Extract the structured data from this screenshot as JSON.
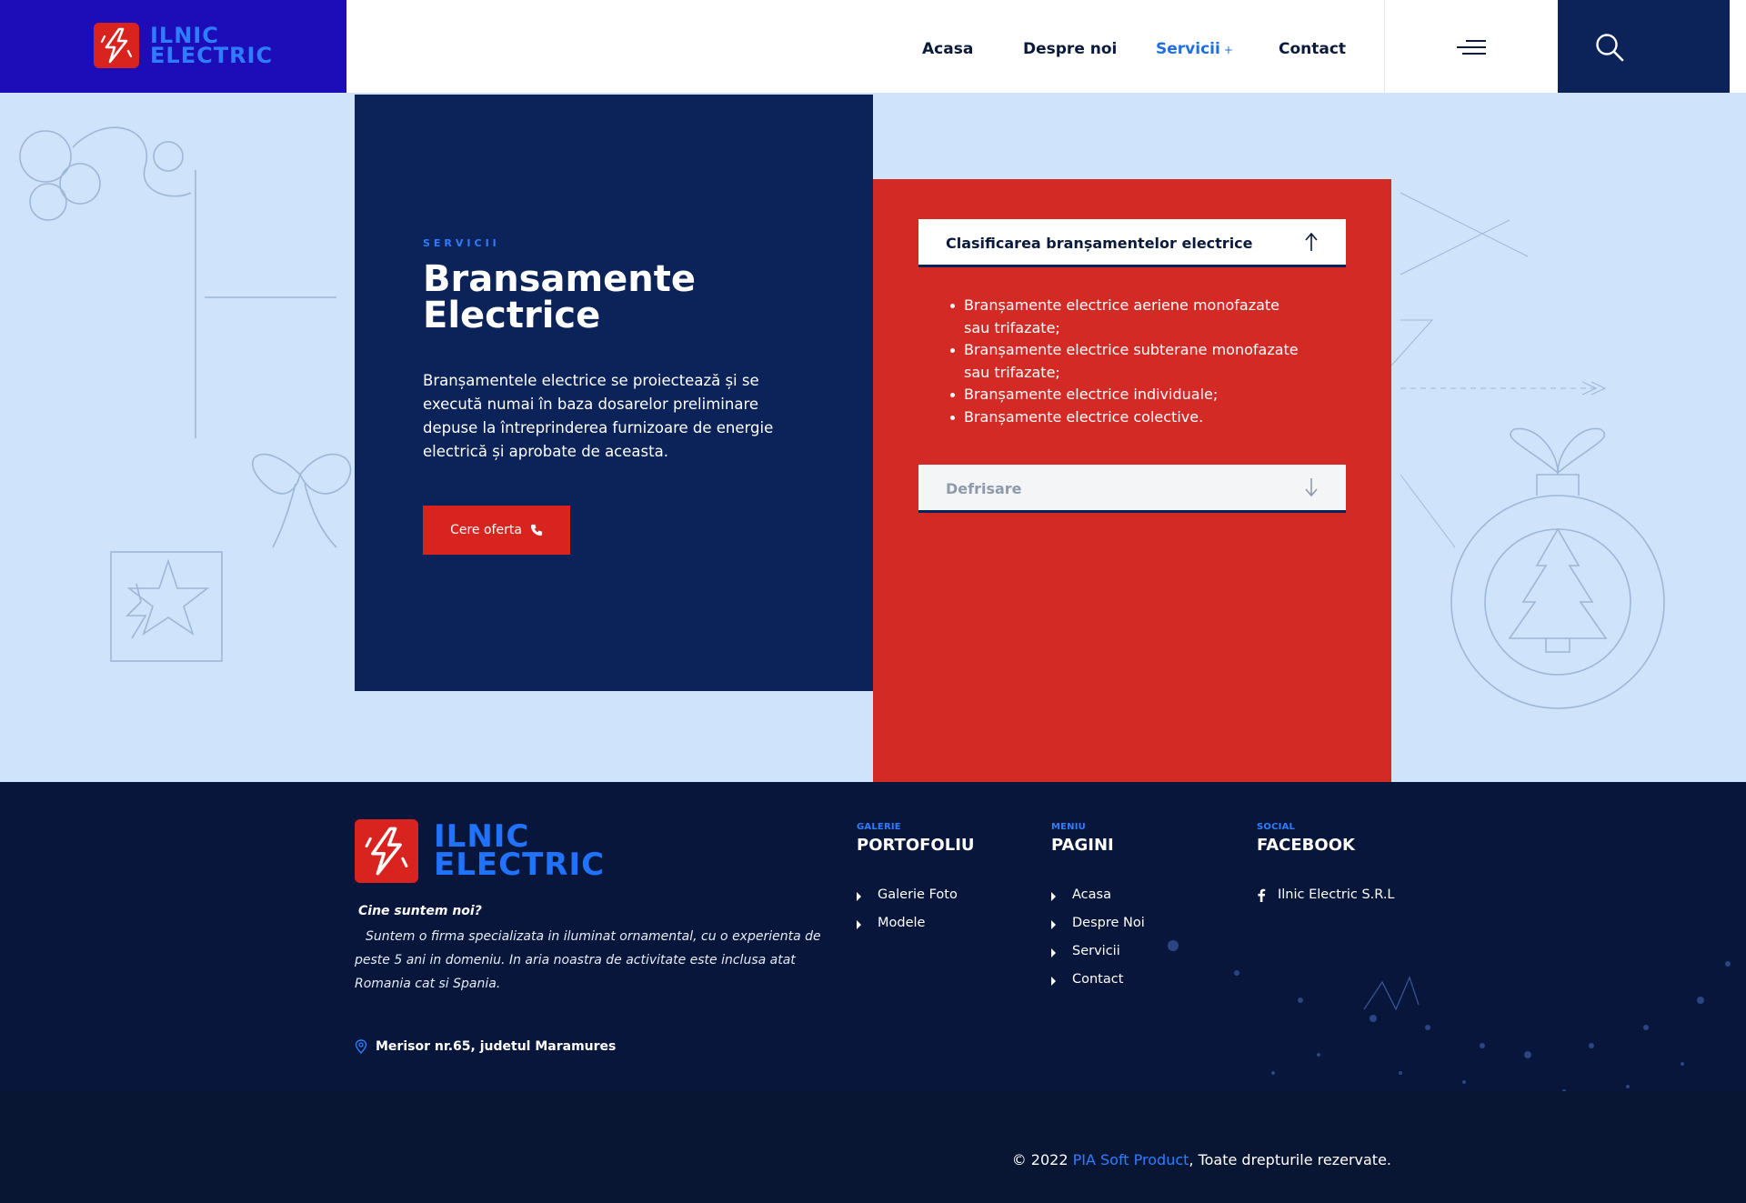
{
  "brand": {
    "name_line1": "ILNIC",
    "name_line2": "ELECTRIC",
    "colors": {
      "logo_bg": "#1c0db8",
      "navy": "#0b2359",
      "red": "#d42a26",
      "accent_blue": "#2f7dff",
      "footer_bg": "#07163a"
    }
  },
  "nav": {
    "items": [
      {
        "label": "Acasa"
      },
      {
        "label": "Despre noi"
      },
      {
        "label": "Servicii",
        "suffix": "+"
      },
      {
        "label": "Contact"
      }
    ],
    "active": "Servicii",
    "icons": {
      "menu": "hamburger-menu-icon",
      "search": "search-icon"
    }
  },
  "hero": {
    "eyebrow": "SERVICII",
    "title": "Bransamente Electrice",
    "text": "Branșamentele electrice se proiectează și se execută numai în baza dosarelor preliminare depuse la întreprinderea furnizoare de energie electrică și aprobate de aceasta.",
    "button_label": "Cere oferta",
    "button_icon": "phone-icon"
  },
  "accordion": {
    "items": [
      {
        "title": "Clasificarea branșamentelor electrice",
        "state": "expanded",
        "arrow_icon": "arrow-up-icon",
        "bullets": [
          "Branșamente electrice aeriene monofazate sau trifazate;",
          "Branșamente electrice subterane monofazate sau trifazate;",
          "Branșamente electrice individuale;",
          "Branșamente electrice colective."
        ]
      },
      {
        "title": "Defrisare",
        "state": "collapsed",
        "arrow_icon": "arrow-down-icon"
      }
    ]
  },
  "footer": {
    "about_title": "Cine suntem noi?",
    "about_text": "Suntem o firma specializata in iluminat ornamental, cu o experienta de peste 5 ani in domeniu. In aria noastra de activitate este inclusa atat Romania cat si Spania.",
    "address": "Merisor nr.65, judetul Maramures",
    "columns": {
      "gallery": {
        "eyebrow": "GALERIE",
        "title": "PORTOFOLIU",
        "links": [
          "Galerie Foto",
          "Modele"
        ]
      },
      "menu": {
        "eyebrow": "MENIU",
        "title": "PAGINI",
        "links": [
          "Acasa",
          "Despre Noi",
          "Servicii",
          "Contact"
        ]
      },
      "social": {
        "eyebrow": "SOCIAL",
        "title": "FACEBOOK",
        "links": [
          "Ilnic Electric S.R.L"
        ]
      }
    },
    "copyright_prefix": "© 2022 ",
    "copyright_link": "PIA Soft Product",
    "copyright_suffix": ", Toate drepturile rezervate."
  }
}
